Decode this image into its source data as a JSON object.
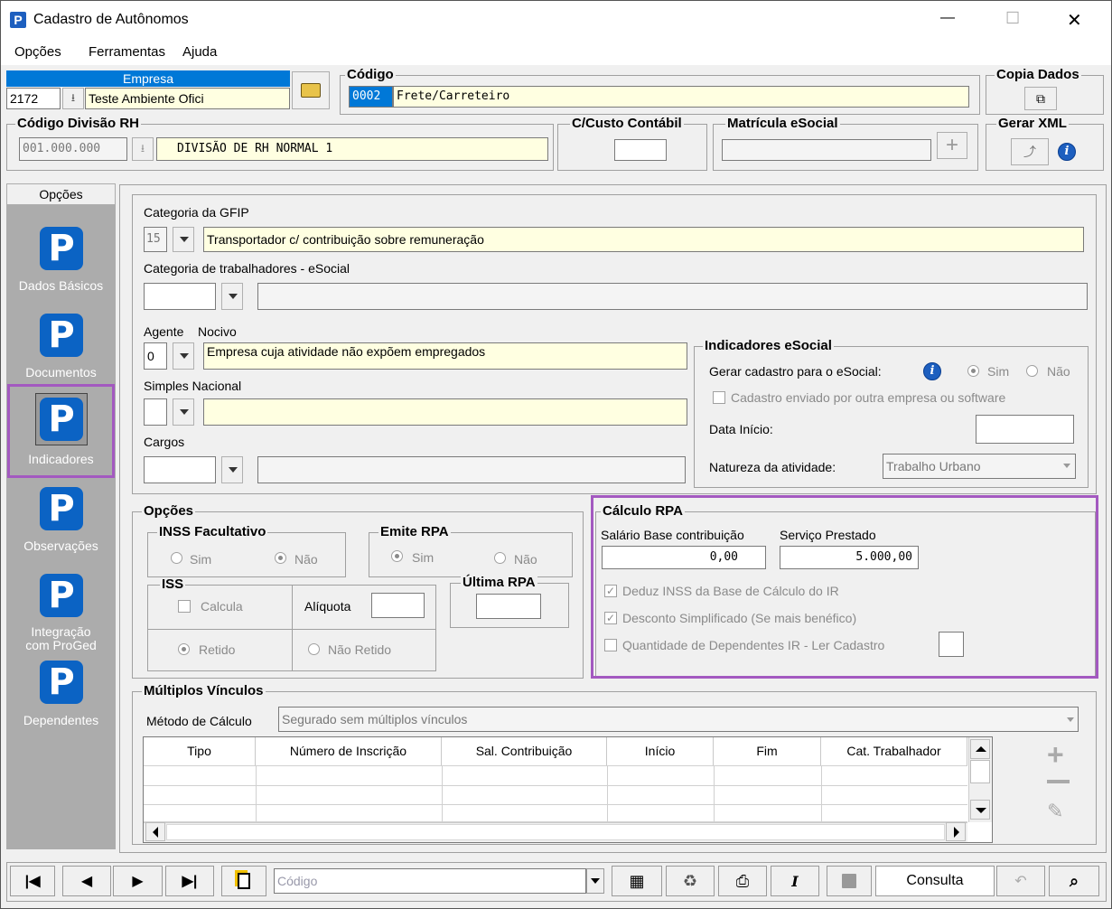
{
  "window": {
    "title": "Cadastro de Autônomos",
    "minimize": "—",
    "maximize": "☐",
    "close": "✕"
  },
  "menu": [
    "Opções",
    "Ferramentas",
    "Ajuda"
  ],
  "empresa": {
    "header": "Empresa",
    "code": "2172",
    "name": "Teste Ambiente Ofici"
  },
  "codigo": {
    "label": "Código",
    "code": "0002",
    "name": "Frete/Carreteiro"
  },
  "copia_dados": {
    "label": "Copia Dados"
  },
  "divisao": {
    "label": "Código Divisão RH",
    "code": "001.000.000",
    "name": "DIVISÃO DE RH NORMAL 1"
  },
  "custo": {
    "label": "C/Custo Contábil",
    "value": ""
  },
  "matricula": {
    "label": "Matrícula eSocial",
    "value": ""
  },
  "gerar_xml": {
    "label": "Gerar XML"
  },
  "sidebar": {
    "header": "Opções",
    "items": [
      {
        "label": "Dados Básicos"
      },
      {
        "label": "Documentos"
      },
      {
        "label": "Indicadores"
      },
      {
        "label": "Observações"
      },
      {
        "label": "Integração com ProGed",
        "line1": "Integração",
        "line2": "com ProGed"
      },
      {
        "label": "Dependentes"
      }
    ]
  },
  "gfip": {
    "label": "Categoria da GFIP",
    "code": "15",
    "value": "Transportador c/ contribuição sobre remuneração"
  },
  "cat_esocial": {
    "label": "Categoria de trabalhadores - eSocial",
    "code": "",
    "value": ""
  },
  "agente": {
    "label1": "Agente",
    "label2": "Nocivo",
    "code": "0",
    "value": "Empresa cuja atividade não expõem empregados"
  },
  "simples": {
    "label": "Simples Nacional",
    "code": "",
    "value": ""
  },
  "cargos": {
    "label": "Cargos",
    "code": "",
    "value": ""
  },
  "ind_esocial": {
    "label": "Indicadores eSocial",
    "gerar_label": "Gerar cadastro para o eSocial:",
    "sim": "Sim",
    "nao": "Não",
    "enviado_label": "Cadastro enviado por outra empresa ou software",
    "data_label": "Data Início:",
    "data_value": "",
    "natureza_label": "Natureza da atividade:",
    "natureza_value": "Trabalho Urbano"
  },
  "opcoes": {
    "label": "Opções",
    "inss": {
      "label": "INSS Facultativo",
      "sim": "Sim",
      "nao": "Não",
      "selected": "Não"
    },
    "emite": {
      "label": "Emite RPA",
      "sim": "Sim",
      "nao": "Não",
      "selected": "Sim"
    },
    "iss": {
      "label": "ISS",
      "calcula": "Calcula",
      "aliquota": "Alíquota",
      "aliquota_value": "",
      "retido": "Retido",
      "nao_retido": "Não Retido",
      "selected": "Retido"
    },
    "ultima": {
      "label": "Última RPA",
      "value": ""
    }
  },
  "calculo_rpa": {
    "label": "Cálculo RPA",
    "salario_label": "Salário Base contribuição",
    "salario_value": "0,00",
    "servico_label": "Serviço Prestado",
    "servico_value": "5.000,00",
    "deduz_label": "Deduz INSS da Base de Cálculo do IR",
    "deduz_checked": true,
    "desconto_label": "Desconto Simplificado (Se mais benéfico)",
    "desconto_checked": true,
    "dependentes_label": "Quantidade de Dependentes IR - Ler Cadastro",
    "dependentes_checked": false,
    "dependentes_value": ""
  },
  "multiplos": {
    "label": "Múltiplos Vínculos",
    "metodo_label": "Método de Cálculo",
    "metodo_value": "Segurado sem múltiplos vínculos",
    "columns": [
      "Tipo",
      "Número de Inscrição",
      "Sal. Contribuição",
      "Início",
      "Fim",
      "Cat. Trabalhador"
    ]
  },
  "toolbar": {
    "search_placeholder": "Código",
    "status": "Consulta"
  },
  "colors": {
    "highlight": "#a359c0",
    "field_yellow": "#ffffe1",
    "brand_blue": "#0b63c4",
    "selection": "#0078d7"
  }
}
